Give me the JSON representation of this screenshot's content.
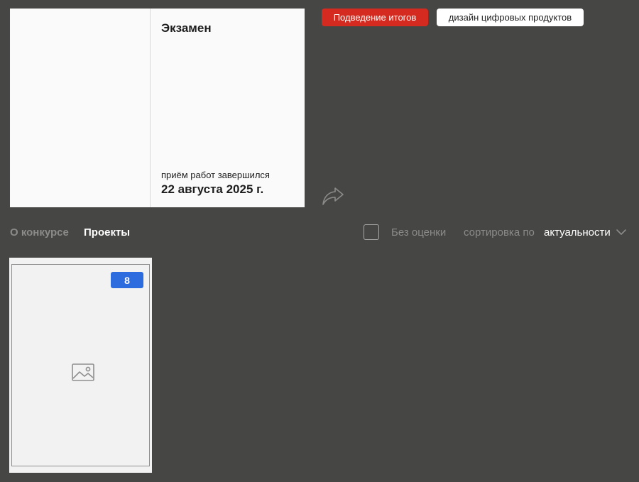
{
  "contest": {
    "title": "Экзамен",
    "deadline_caption": "приём работ завершился",
    "deadline_date": "22 августа 2025 г."
  },
  "tags": {
    "status": "Подведение итогов",
    "category": "дизайн цифровых продуктов"
  },
  "colors": {
    "background": "#464644",
    "status_tag": "#d42a1f",
    "badge": "#2d6cdf",
    "card": "#fafafa"
  },
  "icons": {
    "share": "share-arrow-icon",
    "chevron": "chevron-down-icon",
    "image_placeholder": "image-placeholder-icon"
  },
  "tabs": [
    {
      "label": "О конкурсе",
      "active": false
    },
    {
      "label": "Проекты",
      "active": true
    }
  ],
  "filters": {
    "no_rating_label": "Без оценки",
    "no_rating_checked": false,
    "sort_prefix": "сортировка по",
    "sort_value": "актуальности"
  },
  "projects": [
    {
      "badge": "8"
    }
  ]
}
